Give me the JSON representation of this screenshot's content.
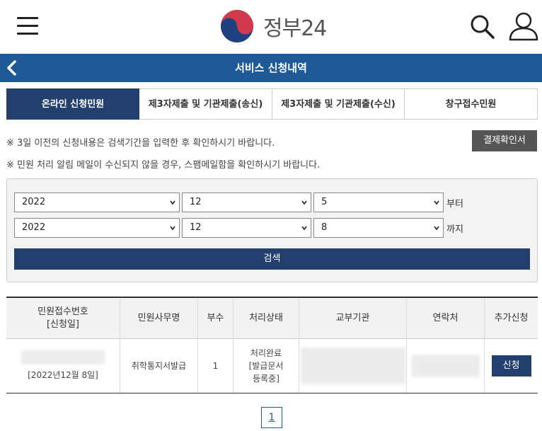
{
  "header": {
    "logo_text": "정부24",
    "icons": {
      "menu": "hamburger-menu-icon",
      "search": "search-icon",
      "user": "user-icon"
    }
  },
  "titlebar": {
    "title": "서비스 신청내역",
    "back_icon": "chevron-left-icon"
  },
  "tabs": [
    {
      "label": "온라인 신청민원",
      "active": true
    },
    {
      "label": "제3자제출 및 기관제출(송신)",
      "active": false
    },
    {
      "label": "제3자제출 및 기관제출(수신)",
      "active": false
    },
    {
      "label": "창구접수민원",
      "active": false
    }
  ],
  "notices": {
    "line1": "※ 3일 이전의 신청내용은 검색기간을 입력한 후 확인하시기 바랍니다.",
    "line2": "※ 민원 처리 알림 메일이 수신되지 않을 경우, 스팸메일함을 확인하시기 바랍니다.",
    "receipt_button": "결제확인서"
  },
  "search": {
    "from": {
      "year": "2022",
      "month": "12",
      "day": "5",
      "suffix": "부터"
    },
    "to": {
      "year": "2022",
      "month": "12",
      "day": "8",
      "suffix": "까지"
    },
    "button": "검색"
  },
  "table": {
    "headers": [
      "민원접수번호",
      "[신청일]",
      "민원사무명",
      "부수",
      "처리상태",
      "교부기관",
      "연락처",
      "추가신청"
    ],
    "rows": [
      {
        "date": "[2022년12월 8일]",
        "name": "취학통지서발급",
        "count": "1",
        "status_lines": [
          "처리완료",
          "[발급문서",
          "등록중]"
        ],
        "action": "신청"
      }
    ]
  },
  "pagination": {
    "current": "1"
  },
  "colors": {
    "primary": "#1e5a96",
    "dark_navy": "#233f6d",
    "gray_button": "#555555"
  }
}
